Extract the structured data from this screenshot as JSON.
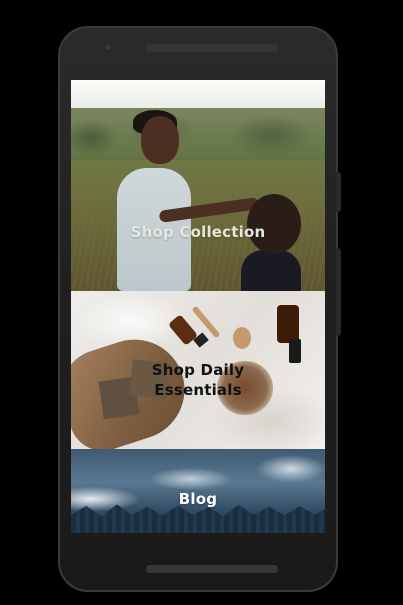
{
  "tiles": [
    {
      "label": "Shop Collection"
    },
    {
      "label": "Shop Daily Essentials"
    },
    {
      "label": "Blog"
    }
  ],
  "colors": {
    "background": "#000000",
    "device": "#222222",
    "label_light": "#e4e6e0",
    "label_dark": "#111111"
  }
}
